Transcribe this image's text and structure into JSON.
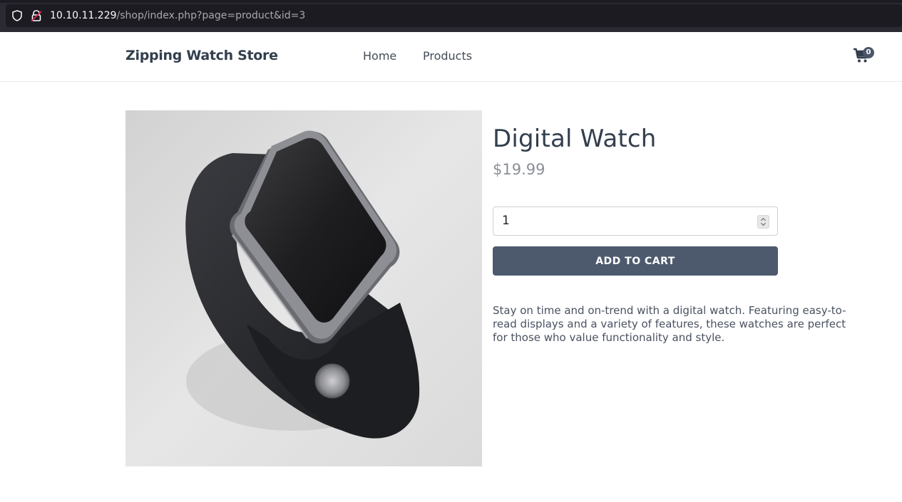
{
  "browser": {
    "url_host": "10.10.11.229",
    "url_path": "/shop/index.php?page=product&id=3"
  },
  "header": {
    "brand": "Zipping Watch Store",
    "nav": [
      {
        "label": "Home"
      },
      {
        "label": "Products"
      }
    ],
    "cart_count": "0",
    "cart_icon": "shopping-cart-icon"
  },
  "product": {
    "title": "Digital Watch",
    "price": "$19.99",
    "quantity": "1",
    "add_to_cart_label": "ADD TO CART",
    "description": "Stay on time and on-trend with a digital watch. Featuring easy-to-read displays and a variety of features, these watches are perfect for those who value functionality and style."
  },
  "colors": {
    "button_bg": "#4d5a6e",
    "brand_text": "#333f4d",
    "price_text": "#8a8f96"
  }
}
